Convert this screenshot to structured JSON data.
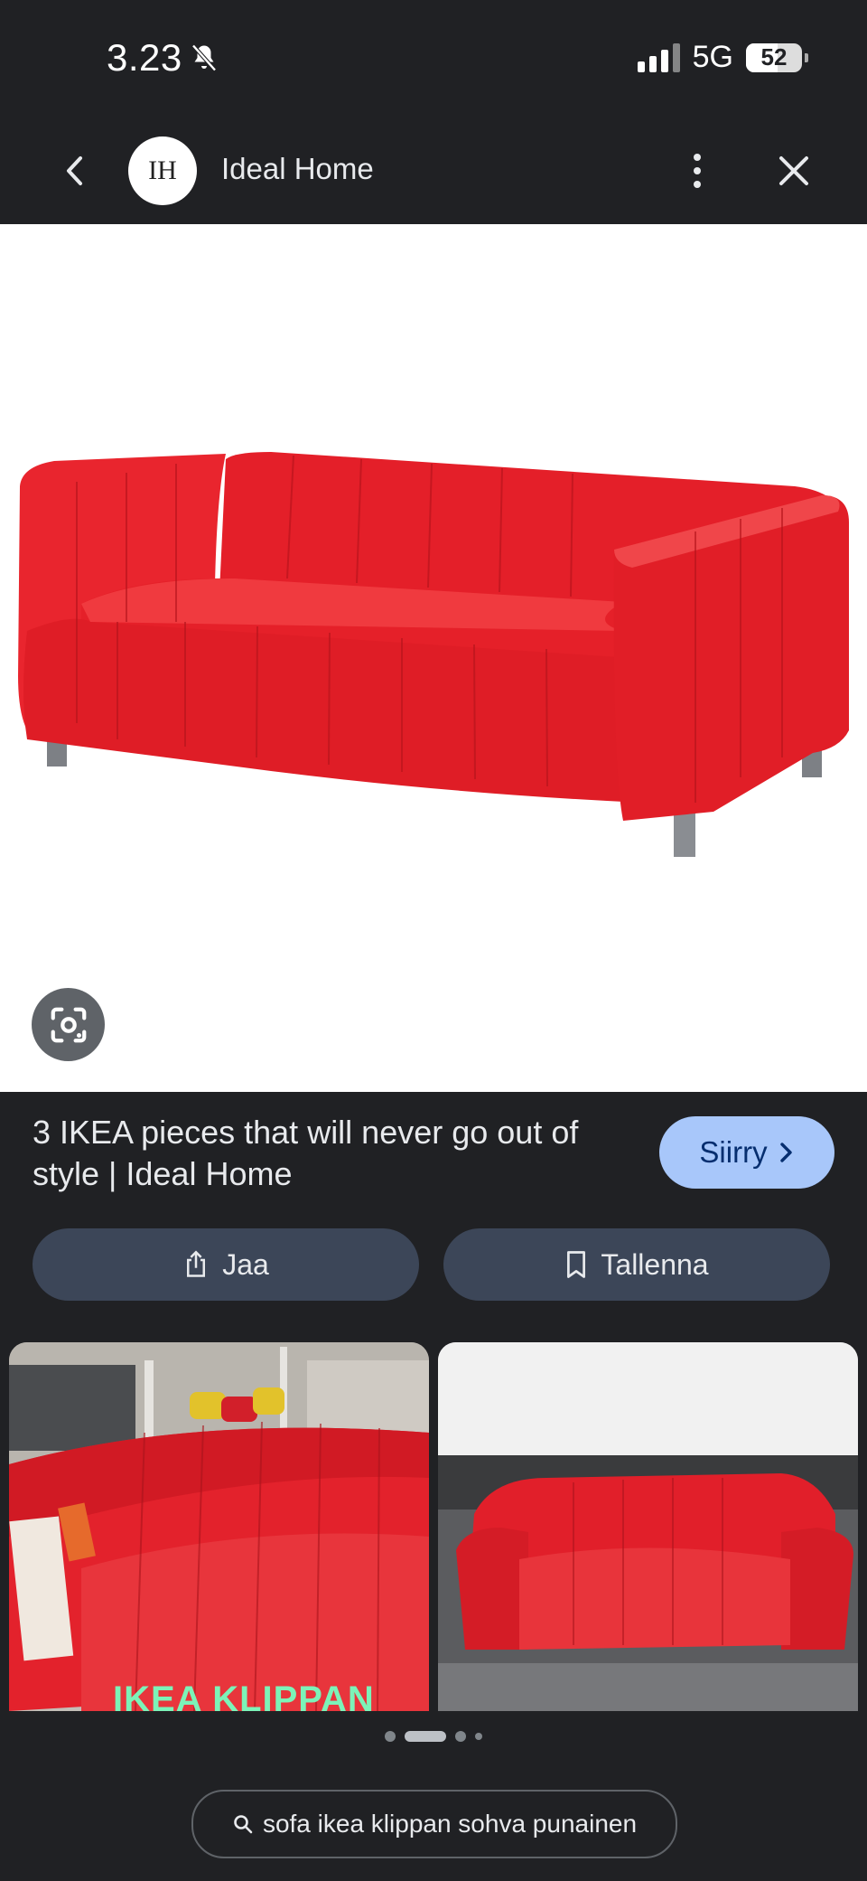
{
  "status_bar": {
    "time": "3.23",
    "network": "5G",
    "battery": "52"
  },
  "header": {
    "site_logo": "IH",
    "site_name": "Ideal Home"
  },
  "result": {
    "title": "3 IKEA pieces that will never go out of style | Ideal Home",
    "visit_label": "Siirry",
    "share_label": "Jaa",
    "save_label": "Tallenna"
  },
  "related": [
    {
      "caption": "IKEA KLIPPAN"
    },
    {
      "caption": ""
    }
  ],
  "carousel": {
    "pages": 4,
    "active": 1
  },
  "search": {
    "query": "sofa ikea klippan sohva punainen"
  },
  "colors": {
    "background": "#202124",
    "sofa": "#e8202a",
    "visit_button": "#a8c7fa",
    "action_button": "#3c4658"
  }
}
